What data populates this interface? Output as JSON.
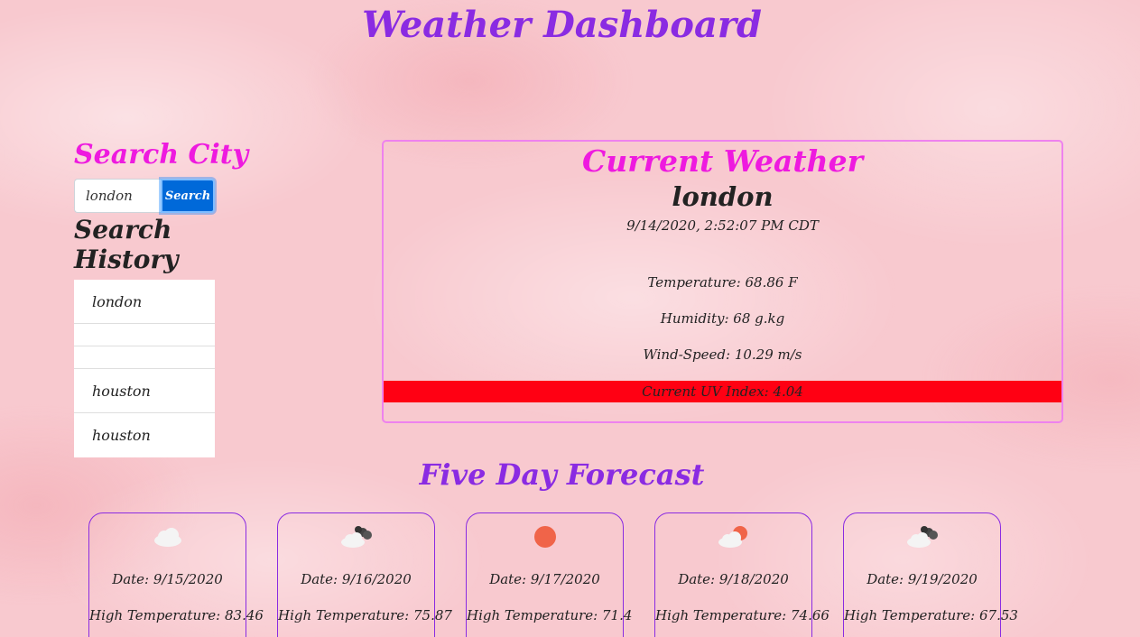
{
  "header": {
    "title": "Weather Dashboard"
  },
  "sidebar": {
    "search_title": "Search City",
    "search_input_value": "london",
    "search_button_label": "Search",
    "history_title": "Search History",
    "history_items": [
      {
        "label": "london"
      },
      {
        "label": ""
      },
      {
        "label": ""
      },
      {
        "label": "houston"
      },
      {
        "label": "houston"
      }
    ]
  },
  "current": {
    "title": "Current Weather",
    "city": "london",
    "datetime": "9/14/2020, 2:52:07 PM CDT",
    "temperature": "Temperature: 68.86 F",
    "humidity": "Humidity: 68 g.kg",
    "wind": "Wind-Speed: 10.29 m/s",
    "uv": "Current UV Index: 4.04",
    "uv_color": "#ff0013"
  },
  "forecast": {
    "title": "Five Day Forecast",
    "days": [
      {
        "icon": "cloud-icon",
        "date": "Date: 9/15/2020",
        "high": "High Temperature: 83.46"
      },
      {
        "icon": "broken-clouds-icon",
        "date": "Date: 9/16/2020",
        "high": "High Temperature: 75.87"
      },
      {
        "icon": "clear-sun-icon",
        "date": "Date: 9/17/2020",
        "high": "High Temperature: 71.4"
      },
      {
        "icon": "partly-cloudy-icon",
        "date": "Date: 9/18/2020",
        "high": "High Temperature: 74.66"
      },
      {
        "icon": "broken-clouds-icon",
        "date": "Date: 9/19/2020",
        "high": "High Temperature: 67.53"
      }
    ]
  },
  "colors": {
    "title": "#8a2be2",
    "section_title": "#ee1adf",
    "card_border": "#ee82ee",
    "button": "#0069d9",
    "background": "#f8c9cf"
  }
}
